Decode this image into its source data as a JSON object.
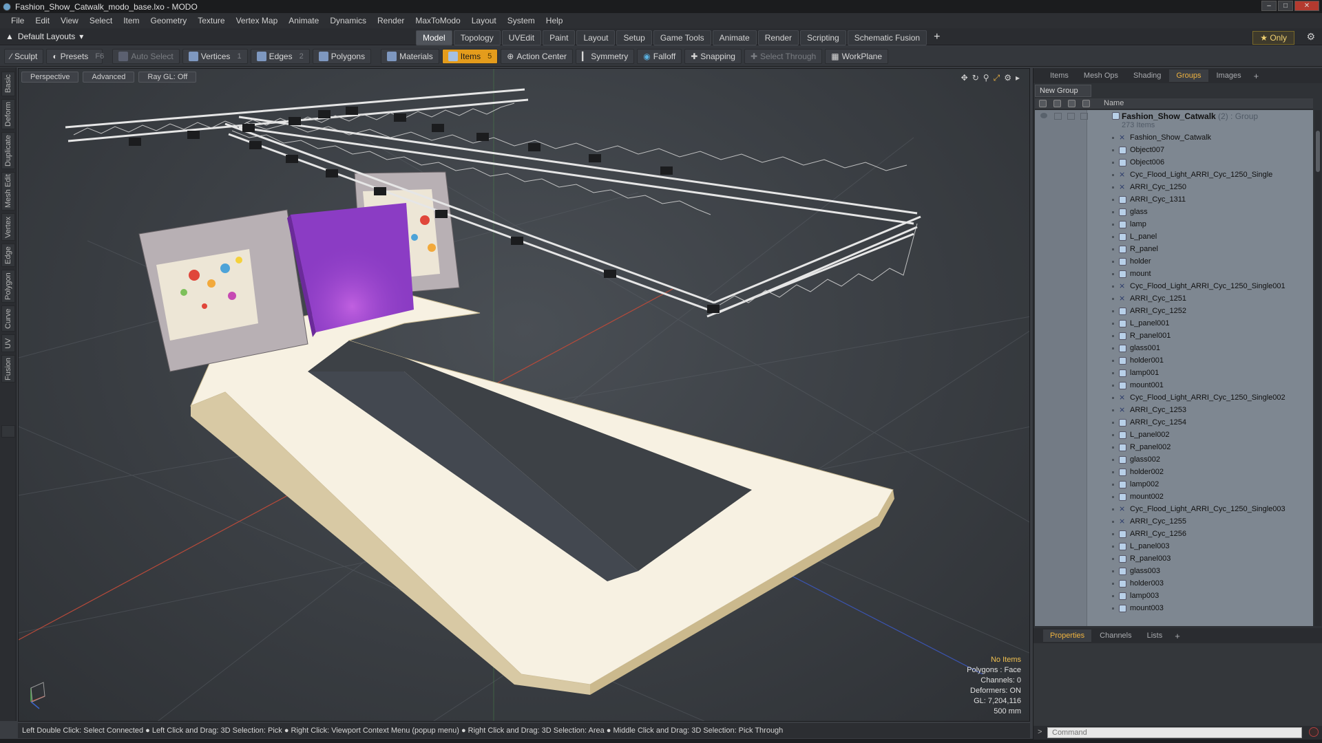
{
  "window": {
    "title": "Fashion_Show_Catwalk_modo_base.lxo - MODO",
    "controls": [
      "minimize",
      "maximize",
      "close"
    ]
  },
  "menu": {
    "items": [
      "File",
      "Edit",
      "View",
      "Select",
      "Item",
      "Geometry",
      "Texture",
      "Vertex Map",
      "Animate",
      "Dynamics",
      "Render",
      "MaxToModo",
      "Layout",
      "System",
      "Help"
    ]
  },
  "layoutbar": {
    "layout_label": "Default Layouts",
    "tabs": [
      {
        "label": "Model",
        "active": true
      },
      {
        "label": "Topology",
        "active": false
      },
      {
        "label": "UVEdit",
        "active": false
      },
      {
        "label": "Paint",
        "active": false
      },
      {
        "label": "Layout",
        "active": false
      },
      {
        "label": "Setup",
        "active": false
      },
      {
        "label": "Game Tools",
        "active": false
      },
      {
        "label": "Animate",
        "active": false
      },
      {
        "label": "Render",
        "active": false
      },
      {
        "label": "Scripting",
        "active": false
      },
      {
        "label": "Schematic Fusion",
        "active": false
      }
    ],
    "plus": "+",
    "only_label": "Only"
  },
  "toolbar": {
    "sculpt": "Sculpt",
    "presets": "Presets",
    "presets_key": "F6",
    "auto_select": "Auto Select",
    "vertices": "Vertices",
    "vertices_key": "1",
    "edges": "Edges",
    "edges_key": "2",
    "polygons": "Polygons",
    "materials": "Materials",
    "items": "Items",
    "items_key": "5",
    "action_center": "Action Center",
    "symmetry": "Symmetry",
    "falloff": "Falloff",
    "snapping": "Snapping",
    "select_through": "Select Through",
    "workplane": "WorkPlane"
  },
  "lefttabs": [
    "Basic",
    "Deform",
    "Duplicate",
    "Mesh Edit",
    "Vertex",
    "Edge",
    "Polygon",
    "Curve",
    "UV",
    "Fusion"
  ],
  "viewport": {
    "view_mode": "Perspective",
    "shading": "Advanced",
    "raygl": "Ray GL: Off",
    "stats": {
      "no_items": "No Items",
      "polygons": "Polygons : Face",
      "channels": "Channels: 0",
      "deformers": "Deformers: ON",
      "gl": "GL: 7,204,116",
      "scale": "500 mm"
    }
  },
  "statusbar": {
    "text": "Left Double Click: Select Connected ● Left Click and Drag: 3D Selection: Pick ● Right Click: Viewport Context Menu (popup menu) ● Right Click and Drag: 3D Selection: Area ● Middle Click and Drag: 3D Selection: Pick Through"
  },
  "rightpanel": {
    "tabs": [
      {
        "label": "Items",
        "active": false
      },
      {
        "label": "Mesh Ops",
        "active": false
      },
      {
        "label": "Shading",
        "active": false
      },
      {
        "label": "Groups",
        "active": true
      },
      {
        "label": "Images",
        "active": false
      }
    ],
    "new_group": "New Group",
    "name_header": "Name",
    "group": {
      "name": "Fashion_Show_Catwalk",
      "suffix": " (2) : Group",
      "count": "273 Items"
    },
    "items": [
      {
        "label": "Fashion_Show_Catwalk",
        "kind": "locator"
      },
      {
        "label": "Object007",
        "kind": "mesh"
      },
      {
        "label": "Object006",
        "kind": "mesh"
      },
      {
        "label": "Cyc_Flood_Light_ARRI_Cyc_1250_Single",
        "kind": "locator"
      },
      {
        "label": "ARRI_Cyc_1250",
        "kind": "locator"
      },
      {
        "label": "ARRI_Cyc_1311",
        "kind": "mesh"
      },
      {
        "label": "glass",
        "kind": "mesh"
      },
      {
        "label": "lamp",
        "kind": "mesh"
      },
      {
        "label": "L_panel",
        "kind": "mesh"
      },
      {
        "label": "R_panel",
        "kind": "mesh"
      },
      {
        "label": "holder",
        "kind": "mesh"
      },
      {
        "label": "mount",
        "kind": "mesh"
      },
      {
        "label": "Cyc_Flood_Light_ARRI_Cyc_1250_Single001",
        "kind": "locator"
      },
      {
        "label": "ARRI_Cyc_1251",
        "kind": "locator"
      },
      {
        "label": "ARRI_Cyc_1252",
        "kind": "mesh"
      },
      {
        "label": "L_panel001",
        "kind": "mesh"
      },
      {
        "label": "R_panel001",
        "kind": "mesh"
      },
      {
        "label": "glass001",
        "kind": "mesh"
      },
      {
        "label": "holder001",
        "kind": "mesh"
      },
      {
        "label": "lamp001",
        "kind": "mesh"
      },
      {
        "label": "mount001",
        "kind": "mesh"
      },
      {
        "label": "Cyc_Flood_Light_ARRI_Cyc_1250_Single002",
        "kind": "locator"
      },
      {
        "label": "ARRI_Cyc_1253",
        "kind": "locator"
      },
      {
        "label": "ARRI_Cyc_1254",
        "kind": "mesh"
      },
      {
        "label": "L_panel002",
        "kind": "mesh"
      },
      {
        "label": "R_panel002",
        "kind": "mesh"
      },
      {
        "label": "glass002",
        "kind": "mesh"
      },
      {
        "label": "holder002",
        "kind": "mesh"
      },
      {
        "label": "lamp002",
        "kind": "mesh"
      },
      {
        "label": "mount002",
        "kind": "mesh"
      },
      {
        "label": "Cyc_Flood_Light_ARRI_Cyc_1250_Single003",
        "kind": "locator"
      },
      {
        "label": "ARRI_Cyc_1255",
        "kind": "locator"
      },
      {
        "label": "ARRI_Cyc_1256",
        "kind": "mesh"
      },
      {
        "label": "L_panel003",
        "kind": "mesh"
      },
      {
        "label": "R_panel003",
        "kind": "mesh"
      },
      {
        "label": "glass003",
        "kind": "mesh"
      },
      {
        "label": "holder003",
        "kind": "mesh"
      },
      {
        "label": "lamp003",
        "kind": "mesh"
      },
      {
        "label": "mount003",
        "kind": "mesh"
      }
    ],
    "bottom_tabs": [
      {
        "label": "Properties",
        "active": true
      },
      {
        "label": "Channels",
        "active": false
      },
      {
        "label": "Lists",
        "active": false
      }
    ],
    "command_placeholder": "Command"
  },
  "colors": {
    "accent": "#e49c1c",
    "tab_active_text": "#f0b440",
    "list_bg": "#7e8791",
    "stage_purple": "#8b3cc4",
    "floor": "#f7f1e2"
  }
}
